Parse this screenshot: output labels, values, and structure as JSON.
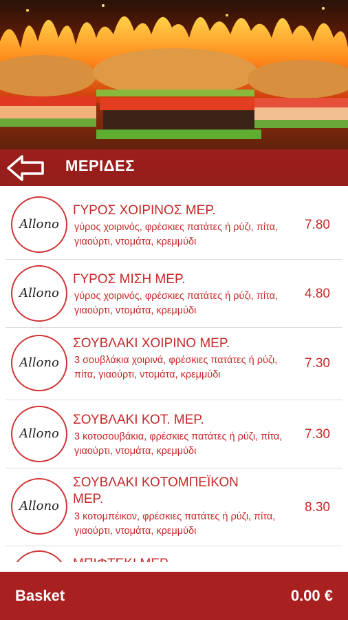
{
  "header": {
    "title": "ΜΕΡΙΔΕΣ",
    "back_icon": "back-arrow-icon",
    "banner": "burger-fire-banner"
  },
  "logo": {
    "word": "Allonο",
    "icon": "leaf-icon"
  },
  "items": [
    {
      "name": "ΓΥΡΟΣ ΧΟΙΡΙΝΟΣ ΜΕΡ.",
      "description": "γύρος χοιρινός, φρέσκιες πατάτες ή ρύζι, πίτα, γιαούρτι, ντομάτα, κρεμμύδι",
      "price": "7.80"
    },
    {
      "name": "ΓΥΡΟΣ ΜΙΣΗ ΜΕΡ.",
      "description": "γύρος χοιρινός, φρέσκιες πατάτες ή ρύζι, πίτα, γιαούρτι, ντομάτα, κρεμμύδι",
      "price": "4.80"
    },
    {
      "name": "ΣΟΥΒΛΑΚΙ ΧΟΙΡΙΝΟ ΜΕΡ.",
      "description": "3 σουβλάκια χοιρινά, φρέσκιες πατάτες ή ρύζι, πίτα, γιαούρτι, ντομάτα, κρεμμύδι",
      "price": "7.30"
    },
    {
      "name": "ΣΟΥΒΛΑΚΙ ΚΟΤ. ΜΕΡ.",
      "description": "3 κοτοσουβάκια, φρέσκιες πατάτες ή ρύζι, πίτα, γιαούρτι, ντομάτα, κρεμμύδι",
      "price": "7.30"
    },
    {
      "name": "ΣΟΥΒΛΑΚΙ ΚΟΤΟΜΠΕΪΚΟΝ ΜΕΡ.",
      "description": "3 κοτομπέικον, φρέσκιες πατάτες ή ρύζι, πίτα, γιαούρτι, ντομάτα, κρεμμύδι",
      "price": "8.30"
    },
    {
      "name": "ΜΠΙΦΤΕΚΙ ΜΕΡ.",
      "description": "",
      "price": ""
    }
  ],
  "basket": {
    "label": "Basket",
    "total": "0.00 €"
  },
  "colors": {
    "accent": "#c62828",
    "bar": "#a8201f",
    "divider": "#dcdcdc"
  }
}
